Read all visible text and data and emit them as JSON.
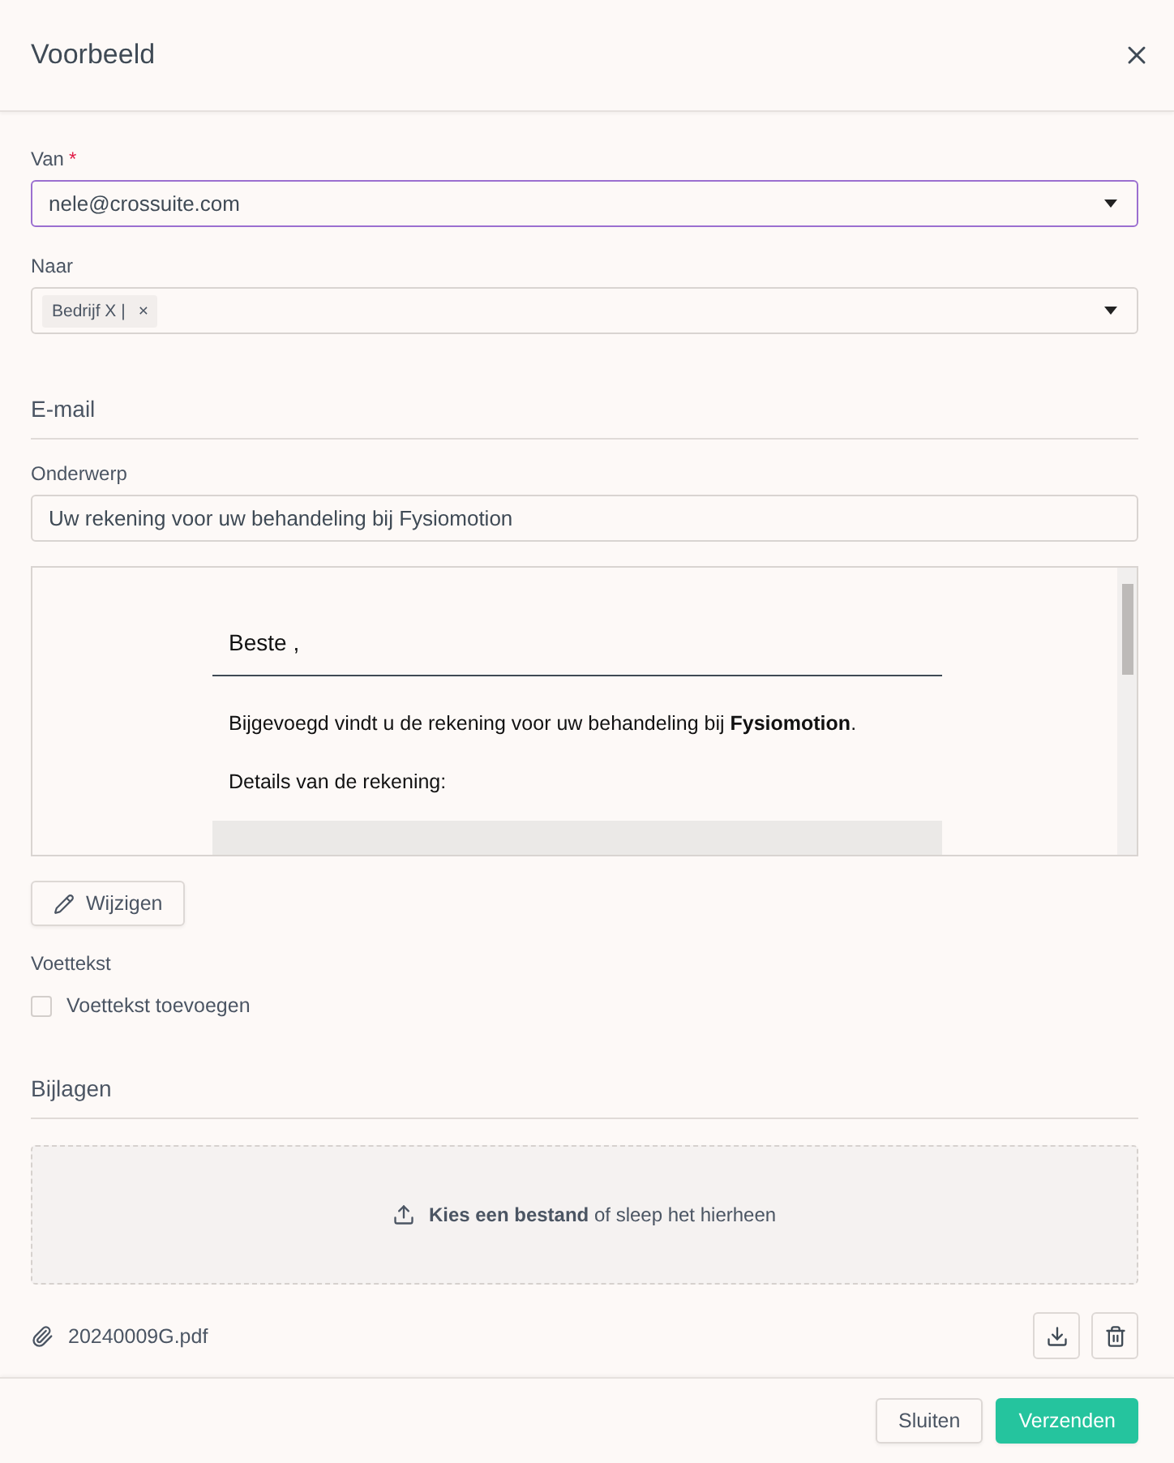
{
  "dialog": {
    "title": "Voorbeeld"
  },
  "from": {
    "label": "Van",
    "required_mark": "*",
    "value": "nele@crossuite.com"
  },
  "to": {
    "label": "Naar",
    "tags": [
      {
        "label": "Bedrijf X |",
        "remove": "×"
      }
    ]
  },
  "email_section": {
    "title": "E-mail"
  },
  "subject": {
    "label": "Onderwerp",
    "value": "Uw rekening voor uw behandeling bij Fysiomotion"
  },
  "preview": {
    "greeting": "Beste ,",
    "paragraphs": [
      "Bijgevoegd vindt u de rekening voor uw behandeling bij **Fysiomotion**.",
      "Details van de rekening:"
    ]
  },
  "edit_button": "Wijzigen",
  "footer_text": {
    "label": "Voettekst",
    "checkbox": {
      "label": "Voettekst toevoegen",
      "checked": false
    }
  },
  "attachments": {
    "title": "Bijlagen",
    "dropzone": "**Kies een bestand** of sleep het hierheen",
    "files": [
      {
        "name": "20240009G.pdf"
      }
    ]
  },
  "buttons": [
    {
      "label": "Sluiten",
      "kind": "secondary"
    },
    {
      "label": "Verzenden",
      "kind": "primary"
    }
  ]
}
